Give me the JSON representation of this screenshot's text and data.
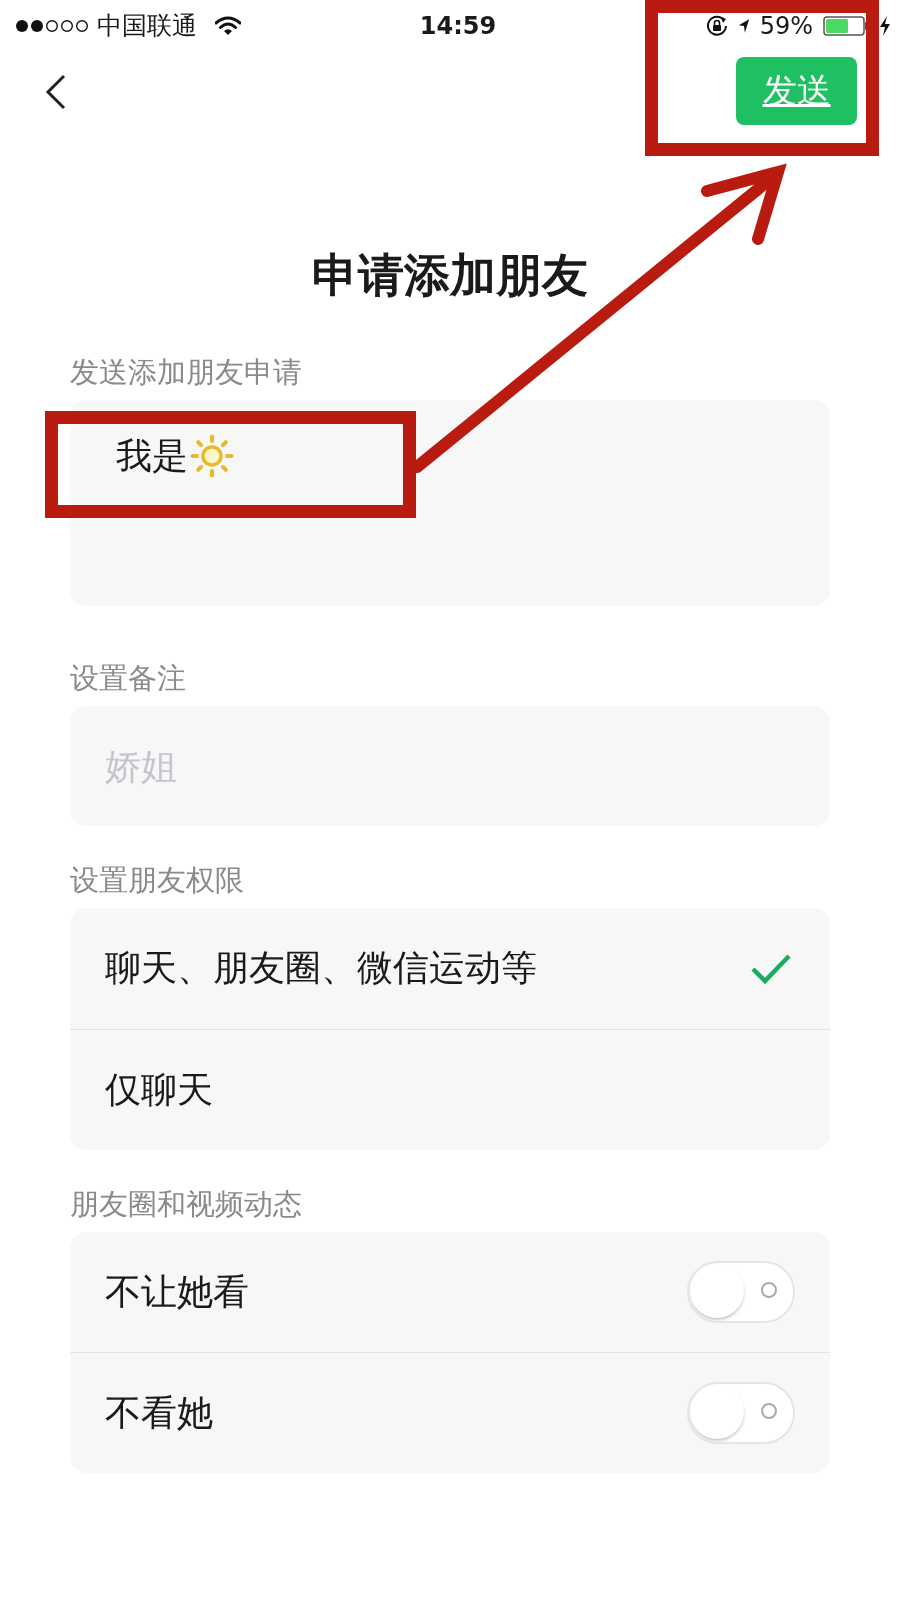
{
  "status_bar": {
    "carrier": "中国联通",
    "time": "14:59",
    "battery": "59%"
  },
  "nav": {
    "send_button": "发送"
  },
  "title": "申请添加朋友",
  "sections": [
    {
      "kind": "textarea",
      "label": "发送添加朋友申请",
      "value": "我是"
    },
    {
      "kind": "input",
      "label": "设置备注",
      "placeholder": "娇姐"
    },
    {
      "kind": "options",
      "label": "设置朋友权限",
      "items": [
        {
          "label": "聊天、朋友圈、微信运动等",
          "selected": true
        },
        {
          "label": "仅聊天",
          "selected": false
        }
      ]
    },
    {
      "kind": "toggles",
      "label": "朋友圈和视频动态",
      "items": [
        {
          "label": "不让她看",
          "on": false
        },
        {
          "label": "不看她",
          "on": false
        }
      ]
    }
  ]
}
